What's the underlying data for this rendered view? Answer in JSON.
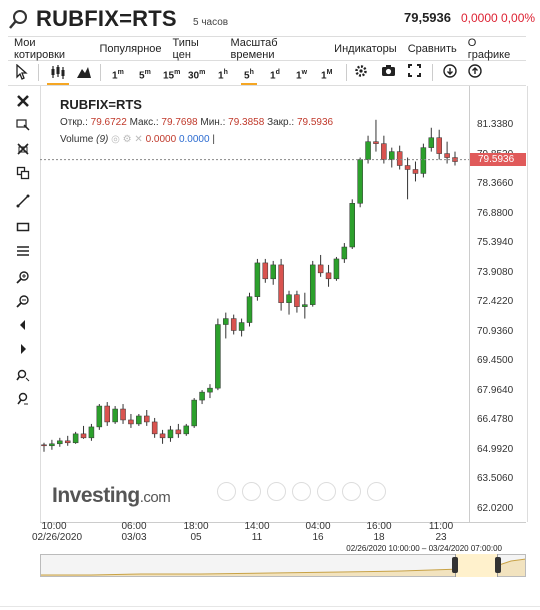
{
  "header": {
    "symbol": "RUBFIX=RTS",
    "interval": "5 часов",
    "price": "79,5936",
    "change": "0,0000 0,00%"
  },
  "menu": [
    "Мои котировки",
    "Популярное",
    "Типы цен",
    "Масштаб времени",
    "Индикаторы",
    "Сравнить",
    "О графике"
  ],
  "toolbar": {
    "timeframes": [
      "1m",
      "5m",
      "15m",
      "30m",
      "1h",
      "5h",
      "1d",
      "1w",
      "1M"
    ],
    "active_timeframe": "5h"
  },
  "legend": {
    "title": "RUBFIX=RTS",
    "open_label": "Откр.:",
    "open": "79.6722",
    "high_label": "Макс.:",
    "high": "79.7698",
    "low_label": "Мин.:",
    "low": "79.3858",
    "close_label": "Закр.:",
    "close": "79.5936",
    "volume_label": "Volume",
    "volume_param": "(9)",
    "volume_v1": "0.0000",
    "volume_v2": "0.0000"
  },
  "price_tag": "79.5936",
  "logo": {
    "main": "Investing",
    "suffix": ".com"
  },
  "range_label": "02/26/2020 10:00:00 – 03/24/2020 07:00:00",
  "colors": {
    "up": "#2ca02c",
    "down": "#d9534f",
    "accent": "#f5a623",
    "change": "#dd2233"
  },
  "chart_data": {
    "type": "candlestick",
    "y_ticks": [
      "81.3380",
      "79.8520",
      "78.3660",
      "76.8800",
      "75.3940",
      "73.9080",
      "72.4220",
      "70.9360",
      "69.4500",
      "67.9640",
      "66.4780",
      "64.9920",
      "63.5060",
      "62.0200"
    ],
    "x_ticks": [
      {
        "time": "10:00",
        "date": "02/26/2020"
      },
      {
        "time": "06:00",
        "date": "03/03"
      },
      {
        "time": "18:00",
        "date": "05"
      },
      {
        "time": "14:00",
        "date": "11"
      },
      {
        "time": "04:00",
        "date": "16"
      },
      {
        "time": "16:00",
        "date": "18"
      },
      {
        "time": "11:00",
        "date": "23"
      }
    ],
    "ylim": [
      62.02,
      81.338
    ],
    "last": 79.5936,
    "candles": [
      [
        65.25,
        65.35,
        64.9,
        65.2
      ],
      [
        65.2,
        65.5,
        65.0,
        65.3
      ],
      [
        65.3,
        65.6,
        65.15,
        65.45
      ],
      [
        65.45,
        65.7,
        65.2,
        65.35
      ],
      [
        65.35,
        65.9,
        65.3,
        65.8
      ],
      [
        65.8,
        66.2,
        65.55,
        65.6
      ],
      [
        65.6,
        66.3,
        65.45,
        66.15
      ],
      [
        66.15,
        67.3,
        66.0,
        67.2
      ],
      [
        67.2,
        67.4,
        66.2,
        66.4
      ],
      [
        66.4,
        67.2,
        66.3,
        67.05
      ],
      [
        67.05,
        67.3,
        66.3,
        66.5
      ],
      [
        66.5,
        66.8,
        66.1,
        66.3
      ],
      [
        66.3,
        66.8,
        66.2,
        66.7
      ],
      [
        66.7,
        67.0,
        66.2,
        66.4
      ],
      [
        66.4,
        66.6,
        65.6,
        65.8
      ],
      [
        65.8,
        66.0,
        65.3,
        65.6
      ],
      [
        65.6,
        66.2,
        65.4,
        66.0
      ],
      [
        66.0,
        66.3,
        65.6,
        65.8
      ],
      [
        65.8,
        66.3,
        65.7,
        66.2
      ],
      [
        66.2,
        67.6,
        66.1,
        67.5
      ],
      [
        67.5,
        68.0,
        67.3,
        67.9
      ],
      [
        67.9,
        68.3,
        67.6,
        68.1
      ],
      [
        68.1,
        71.6,
        68.0,
        71.3
      ],
      [
        71.3,
        71.9,
        70.6,
        71.6
      ],
      [
        71.6,
        71.8,
        70.8,
        71.0
      ],
      [
        71.0,
        71.6,
        70.7,
        71.4
      ],
      [
        71.4,
        72.9,
        71.2,
        72.7
      ],
      [
        72.7,
        74.6,
        72.5,
        74.4
      ],
      [
        74.4,
        74.6,
        73.4,
        73.6
      ],
      [
        73.6,
        74.5,
        73.3,
        74.3
      ],
      [
        74.3,
        74.6,
        72.0,
        72.4
      ],
      [
        72.4,
        73.0,
        71.8,
        72.8
      ],
      [
        72.8,
        73.0,
        71.9,
        72.2
      ],
      [
        72.2,
        72.9,
        71.6,
        72.3
      ],
      [
        72.3,
        74.5,
        72.2,
        74.3
      ],
      [
        74.3,
        74.8,
        73.7,
        73.9
      ],
      [
        73.9,
        74.3,
        73.2,
        73.6
      ],
      [
        73.6,
        74.7,
        73.5,
        74.6
      ],
      [
        74.6,
        75.4,
        74.4,
        75.2
      ],
      [
        75.2,
        77.6,
        75.1,
        77.4
      ],
      [
        77.4,
        79.7,
        77.2,
        79.6
      ],
      [
        79.6,
        80.8,
        79.4,
        80.5
      ],
      [
        80.5,
        81.6,
        80.0,
        80.4
      ],
      [
        80.4,
        80.8,
        79.4,
        79.6
      ],
      [
        79.6,
        80.2,
        79.2,
        80.0
      ],
      [
        80.0,
        80.3,
        79.1,
        79.3
      ],
      [
        79.3,
        79.7,
        77.6,
        79.1
      ],
      [
        79.1,
        79.5,
        78.5,
        78.9
      ],
      [
        78.9,
        80.4,
        78.7,
        80.2
      ],
      [
        80.2,
        81.2,
        80.0,
        80.7
      ],
      [
        80.7,
        81.1,
        79.6,
        79.9
      ],
      [
        79.9,
        80.5,
        79.4,
        79.7
      ],
      [
        79.7,
        80.0,
        79.3,
        79.5
      ]
    ]
  }
}
